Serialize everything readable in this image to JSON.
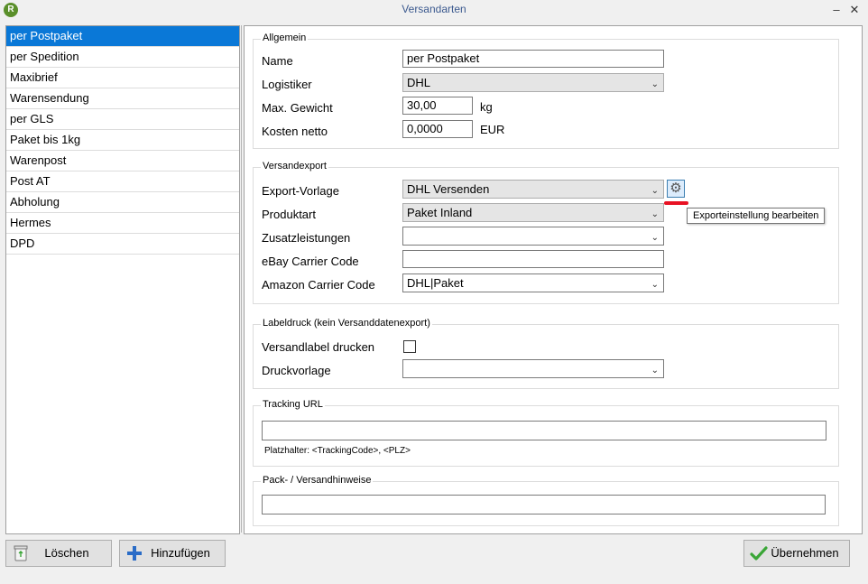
{
  "window": {
    "title": "Versandarten",
    "minimize": "–",
    "close": "✕",
    "app_icon": "app-logo"
  },
  "methods": [
    "per Postpaket",
    "per Spedition",
    "Maxibrief",
    "Warensendung",
    "per GLS",
    "Paket bis 1kg",
    "Warenpost",
    "Post AT",
    "Abholung",
    "Hermes",
    "DPD"
  ],
  "selected_method": "per Postpaket",
  "general": {
    "title": "Allgemein",
    "name_label": "Name",
    "name_value": "per Postpaket",
    "logistics_label": "Logistiker",
    "logistics_value": "DHL",
    "weight_label": "Max. Gewicht",
    "weight_value": "30,00",
    "weight_unit": "kg",
    "cost_label": "Kosten netto",
    "cost_value": "0,0000",
    "cost_unit": "EUR"
  },
  "export": {
    "title": "Versandexport",
    "template_label": "Export-Vorlage",
    "template_value": "DHL Versenden",
    "product_label": "Produktart",
    "product_value": "Paket Inland",
    "extras_label": "Zusatzleistungen",
    "extras_value": "",
    "ebay_label": "eBay Carrier Code",
    "ebay_value": "",
    "amazon_label": "Amazon Carrier Code",
    "amazon_value": "DHL|Paket",
    "tooltip": "Exporteinstellung bearbeiten"
  },
  "label_print": {
    "title": "Labeldruck (kein Versanddatenexport)",
    "print_label": "Versandlabel drucken",
    "template_label": "Druckvorlage",
    "template_value": ""
  },
  "tracking": {
    "title": "Tracking URL",
    "value": "",
    "hint": "Platzhalter: <TrackingCode>, <PLZ>"
  },
  "packing": {
    "title": "Pack- / Versandhinweise",
    "value": ""
  },
  "buttons": {
    "delete": "Löschen",
    "add": "Hinzufügen",
    "apply": "Übernehmen"
  },
  "colors": {
    "selection": "#0a78d7",
    "accent_red": "#e81123",
    "check_green": "#3aa637",
    "plus_blue": "#2a6cc7"
  }
}
